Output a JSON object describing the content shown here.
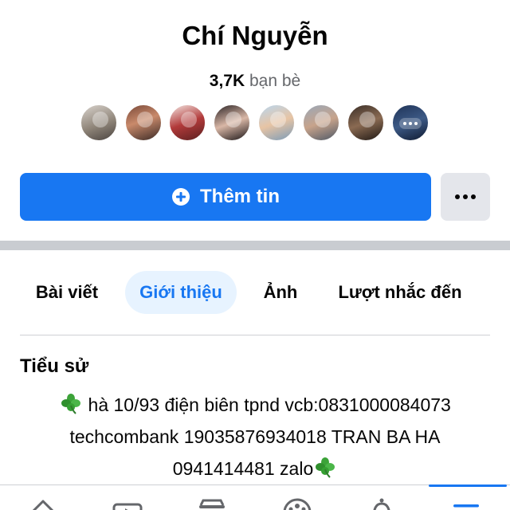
{
  "profile": {
    "name": "Chí Nguyễn",
    "friends_count": "3,7K",
    "friends_label": "bạn bè"
  },
  "actions": {
    "add_label": "Thêm tin"
  },
  "tabs": [
    {
      "label": "Bài viết"
    },
    {
      "label": "Giới thiệu",
      "active": true
    },
    {
      "label": "Ảnh"
    },
    {
      "label": "Lượt nhắc đến"
    }
  ],
  "bio": {
    "title": "Tiểu sử",
    "text": " hà 10/93 điện biên tpnd vcb:0831000084073\ntechcombank  19035876934018 TRAN BA HA\n0941414481 zalo",
    "icon": "four-leaf-clover-icon"
  },
  "nav": {
    "items": [
      "home-icon",
      "video-icon",
      "marketplace-icon",
      "groups-icon",
      "notifications-icon",
      "menu-icon"
    ],
    "active": "menu-icon"
  },
  "colors": {
    "accent": "#1877f2",
    "active_tab_bg": "#e7f3ff",
    "secondary_button_bg": "#e4e6eb",
    "divider": "#c9ccd1"
  }
}
